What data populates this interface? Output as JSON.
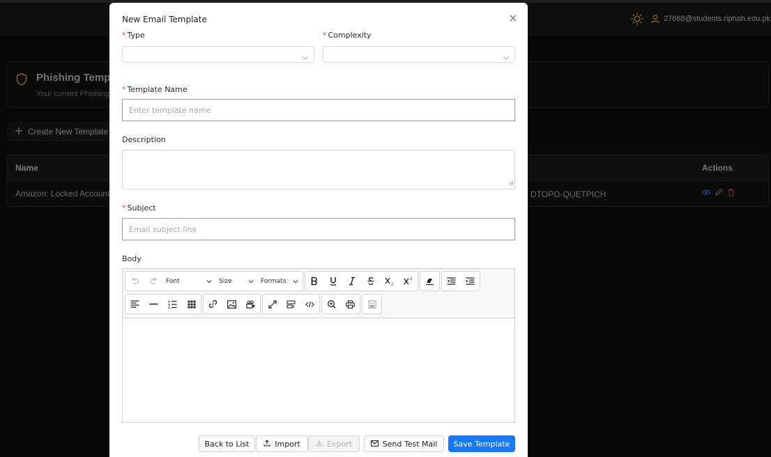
{
  "app": {
    "user_email": "27668@students.riphah.edu.pk",
    "theme_icon": "sun-icon",
    "accent": "#f0a24b"
  },
  "background": {
    "card_title": "Phishing Temp",
    "card_subtitle": "Your current Phishing",
    "create_label": "Create New Template",
    "table": {
      "col_name": "Name",
      "col_actions": "Actions",
      "row_name": "Amazon: Locked Account",
      "row_code": "DTOPO-QUETPICH"
    }
  },
  "modal": {
    "title": "New Email Template",
    "type_label": "Type",
    "complexity_label": "Complexity",
    "template_name_label": "Template Name",
    "template_name_placeholder": "Enter template name",
    "description_label": "Description",
    "subject_label": "Subject",
    "subject_placeholder": "Email subject line",
    "body_label": "Body",
    "toolbar": {
      "font": "Font",
      "size": "Size",
      "formats": "Formats"
    },
    "buttons": {
      "back": "Back to List",
      "import": "Import",
      "export": "Export",
      "send_test": "Send Test Mail",
      "save": "Save Template"
    },
    "primary_color": "#1677ff",
    "required_color": "#e5484d"
  }
}
